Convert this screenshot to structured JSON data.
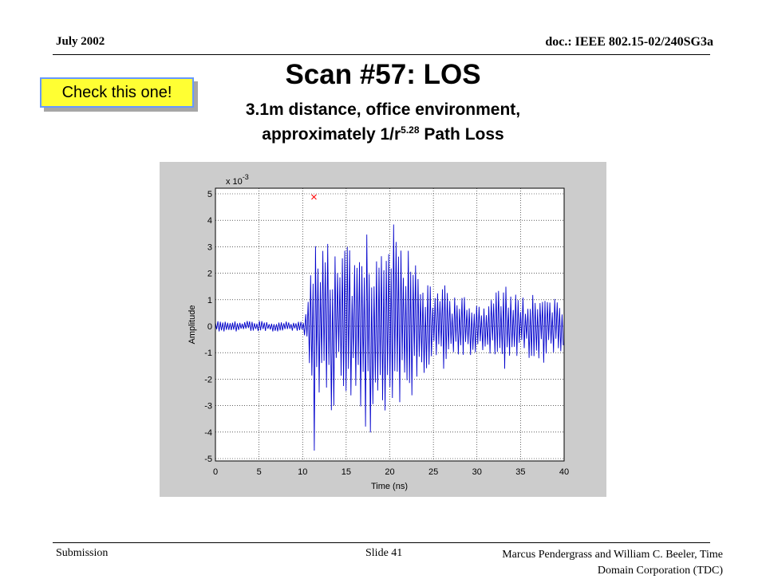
{
  "header": {
    "date": "July 2002",
    "doc": "doc.: IEEE 802.15-02/240SG3a"
  },
  "slide": {
    "title": "Scan #57:  LOS",
    "subtitle_line1": "3.1m distance, office environment,",
    "subtitle_line2_pre": "approximately 1/r",
    "subtitle_line2_exp": "5.28",
    "subtitle_line2_post": " Path Loss",
    "callout": "Check this one!"
  },
  "footer": {
    "left": "Submission",
    "center": "Slide 41",
    "right_line1": "Marcus Pendergrass and William  C. Beeler, Time",
    "right_line2": "Domain Corporation (TDC)"
  },
  "colors": {
    "trace": "#0000cc",
    "marker": "#ff0000",
    "panel": "#cccccc",
    "callout_fill": "#ffff33",
    "callout_border": "#6699ff"
  },
  "chart_data": {
    "type": "line",
    "xlabel": "Time (ns)",
    "ylabel": "Amplitude",
    "y_multiplier_label": "x 10",
    "y_multiplier_exp": "-3",
    "xlim": [
      0,
      40
    ],
    "ylim": [
      -5,
      5
    ],
    "xticks": [
      "0",
      "5",
      "10",
      "15",
      "20",
      "25",
      "30",
      "35",
      "40"
    ],
    "yticks": [
      "5",
      "4",
      "3",
      "2",
      "1",
      "0",
      "-1",
      "-2",
      "-3",
      "-4",
      "-5"
    ],
    "grid": true,
    "peak_marker": {
      "x": 11.3,
      "y": 4.7,
      "symbol": "x"
    },
    "series": [
      {
        "envelope": [
          [
            0,
            0.2
          ],
          [
            10,
            0.2
          ],
          [
            10.7,
            1.0
          ],
          [
            11.0,
            4.0
          ],
          [
            11.3,
            4.7
          ],
          [
            11.6,
            3.8
          ],
          [
            12.0,
            3.0
          ],
          [
            13.0,
            3.6
          ],
          [
            14.0,
            2.6
          ],
          [
            15.0,
            3.2
          ],
          [
            16.0,
            2.6
          ],
          [
            17.0,
            3.7
          ],
          [
            18.0,
            4.2
          ],
          [
            19.0,
            3.8
          ],
          [
            20.0,
            3.3
          ],
          [
            20.5,
            4.0
          ],
          [
            21.0,
            2.8
          ],
          [
            22.0,
            3.4
          ],
          [
            23.0,
            2.5
          ],
          [
            24.0,
            1.8
          ],
          [
            25.0,
            1.4
          ],
          [
            26.0,
            1.8
          ],
          [
            27.0,
            1.3
          ],
          [
            28.0,
            1.1
          ],
          [
            29.0,
            1.2
          ],
          [
            30.0,
            1.3
          ],
          [
            31.0,
            1.0
          ],
          [
            32.0,
            1.2
          ],
          [
            33.0,
            1.8
          ],
          [
            34.0,
            1.3
          ],
          [
            35.0,
            1.1
          ],
          [
            36.0,
            1.4
          ],
          [
            37.0,
            1.2
          ],
          [
            38.0,
            1.5
          ],
          [
            39.0,
            1.1
          ],
          [
            40.0,
            0.9
          ]
        ],
        "cycle_ns": 0.28
      }
    ]
  }
}
